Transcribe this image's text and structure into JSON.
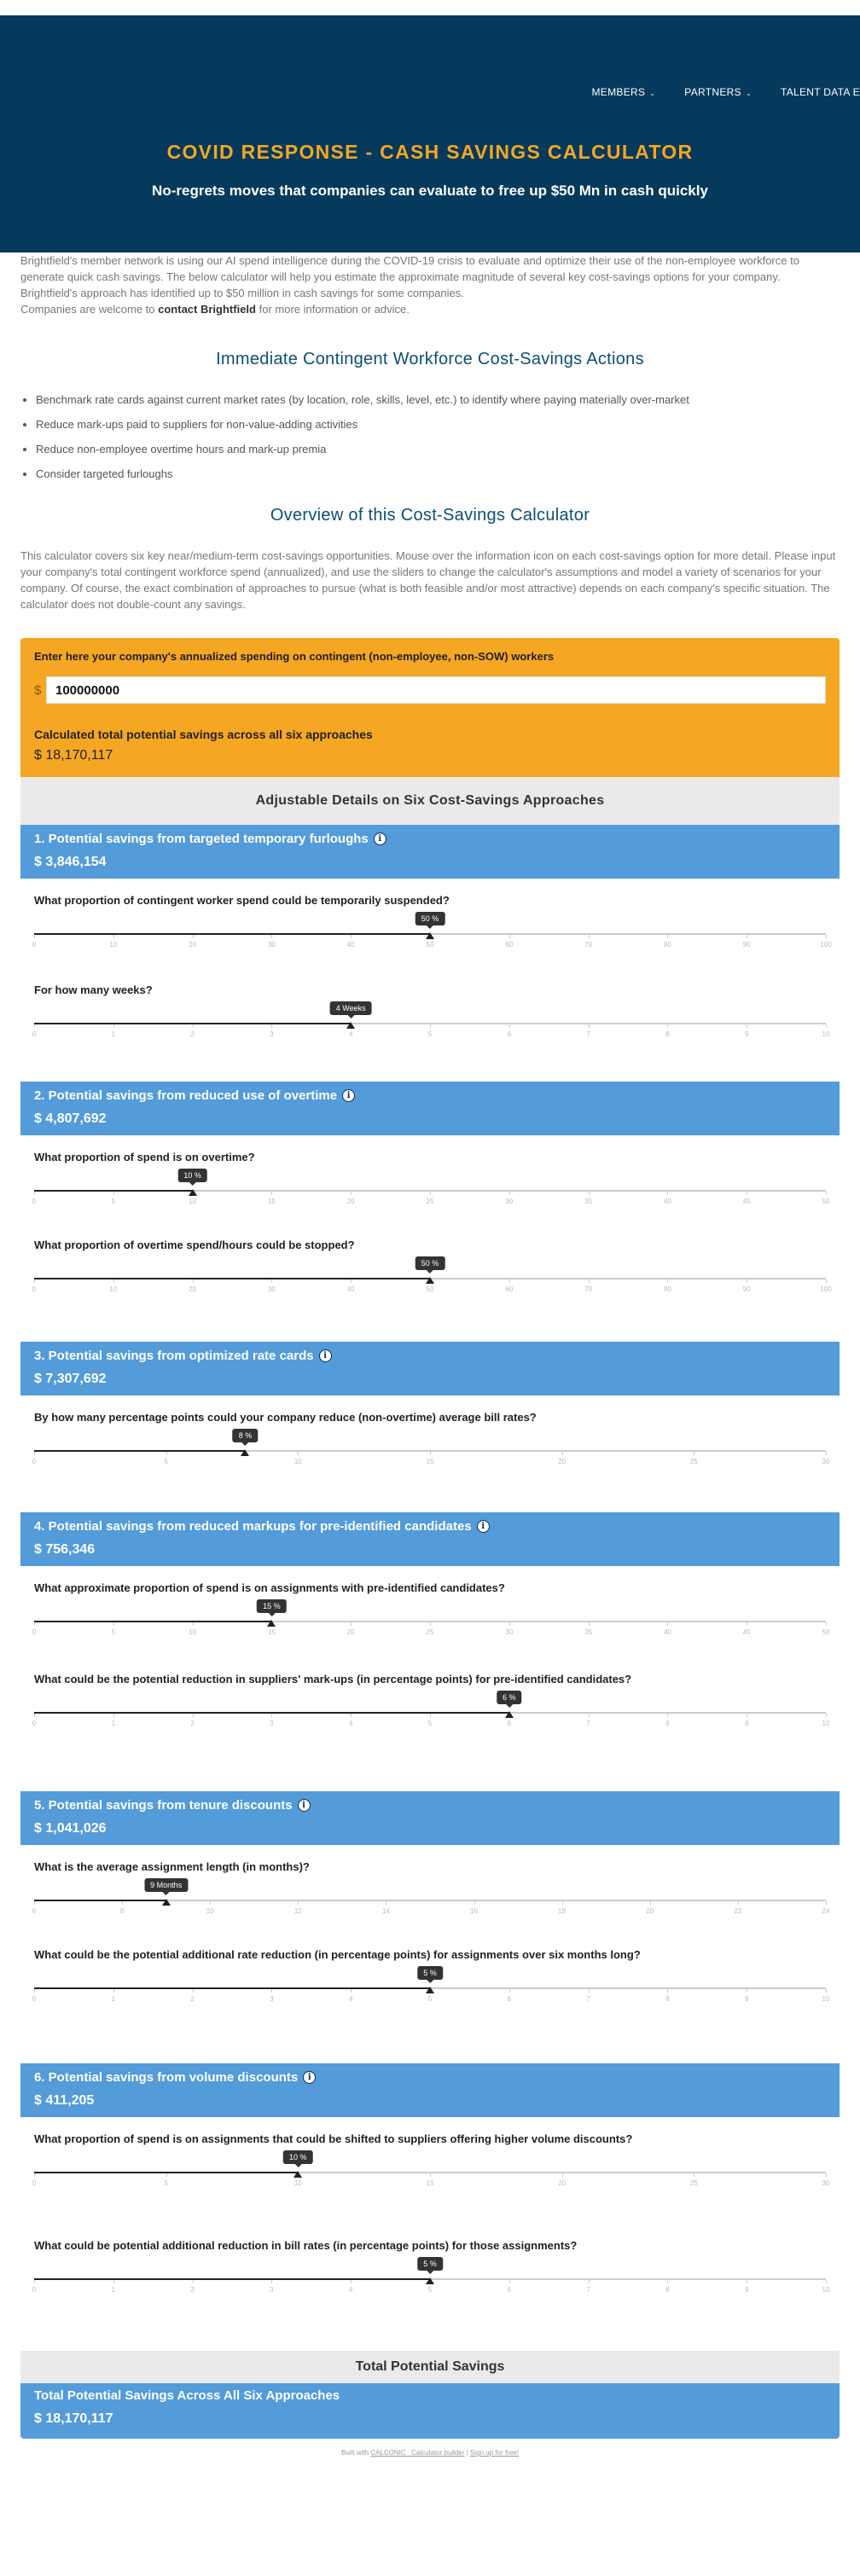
{
  "nav": {
    "items": [
      "MEMBERS",
      "PARTNERS",
      "TALENT DATA E"
    ]
  },
  "hero": {
    "title": "COVID RESPONSE - CASH SAVINGS CALCULATOR",
    "subtitle": "No-regrets moves that companies can evaluate to free up $50 Mn in cash quickly"
  },
  "intro": {
    "paragraph": "Brightfield's member network is using our AI spend intelligence during the COVID-19 crisis to evaluate and optimize their use of the non-employee workforce to generate quick cash savings. The below calculator will help you estimate the approximate magnitude of several key cost-savings options for your company. Brightfield's approach has identified up to $50 million in cash savings for some companies.",
    "contact_prefix": "Companies are welcome to ",
    "contact_bold": "contact Brightfield",
    "contact_suffix": " for more information or advice."
  },
  "actions": {
    "heading": "Immediate Contingent Workforce Cost-Savings Actions",
    "items": [
      "Benchmark rate cards against current market rates (by location, role, skills, level, etc.) to identify where paying materially over-market",
      "Reduce mark-ups paid to suppliers for non-value-adding activities",
      "Reduce non-employee overtime hours and mark-up premia",
      "Consider targeted furloughs"
    ]
  },
  "overview": {
    "heading": "Overview of this Cost-Savings Calculator",
    "paragraph": "This calculator covers six key near/medium-term cost-savings opportunities. Mouse over the information icon on each cost-savings option for more detail. Please input your company's total contingent workforce spend (annualized), and use the sliders to change the calculator's assumptions and model a variety of scenarios for your company.  Of course, the exact combination of approaches to pursue (what is both feasible and/or most attractive) depends on each company's specific situation. The calculator does not double-count any savings."
  },
  "inputs": {
    "spend_label": "Enter here your company's annualized spending on contingent (non-employee, non-SOW) workers",
    "currency": "$",
    "spend_value": "100000000",
    "calc_label": "Calculated total potential savings across all six approaches",
    "calc_value": "$ 18,170,117"
  },
  "adjustable_heading": "Adjustable Details on Six Cost-Savings Approaches",
  "sections": [
    {
      "title": "1. Potential savings from targeted temporary furloughs",
      "value": "$ 3,846,154",
      "sliders": [
        {
          "question": "What proportion of contingent worker spend could be temporarily suspended?",
          "min": 0,
          "max": 100,
          "value": 50,
          "tip": "50 %",
          "ticks": [
            "0",
            "10",
            "20",
            "30",
            "40",
            "50",
            "60",
            "70",
            "80",
            "90",
            "100"
          ]
        },
        {
          "question": "For how many weeks?",
          "min": 0,
          "max": 10,
          "value": 4,
          "tip": "4 Weeks",
          "ticks": [
            "0",
            "1",
            "2",
            "3",
            "4",
            "5",
            "6",
            "7",
            "8",
            "9",
            "10"
          ]
        }
      ]
    },
    {
      "title": "2. Potential savings from reduced use of overtime",
      "value": "$ 4,807,692",
      "sliders": [
        {
          "question": "What proportion of spend is on overtime?",
          "min": 0,
          "max": 50,
          "value": 10,
          "tip": "10 %",
          "ticks": [
            "0",
            "5",
            "10",
            "15",
            "20",
            "25",
            "30",
            "35",
            "40",
            "45",
            "50"
          ]
        },
        {
          "question": "What proportion of overtime spend/hours could be stopped?",
          "min": 0,
          "max": 100,
          "value": 50,
          "tip": "50 %",
          "ticks": [
            "0",
            "10",
            "20",
            "30",
            "40",
            "50",
            "60",
            "70",
            "80",
            "90",
            "100"
          ]
        }
      ]
    },
    {
      "title": "3. Potential savings from optimized rate cards",
      "value": "$ 7,307,692",
      "sliders": [
        {
          "question": "By how many percentage points could your company reduce (non-overtime) average bill rates?",
          "min": 0,
          "max": 30,
          "value": 8,
          "tip": "8 %",
          "ticks": [
            "0",
            "5",
            "10",
            "15",
            "20",
            "25",
            "30"
          ]
        }
      ]
    },
    {
      "title": "4. Potential savings from reduced markups for pre-identified candidates",
      "value": "$ 756,346",
      "sliders": [
        {
          "question": "What approximate proportion of spend is on assignments with pre-identified candidates?",
          "min": 0,
          "max": 50,
          "value": 15,
          "tip": "15 %",
          "ticks": [
            "0",
            "5",
            "10",
            "15",
            "20",
            "25",
            "30",
            "35",
            "40",
            "45",
            "50"
          ]
        },
        {
          "question": "What could be the potential reduction in suppliers' mark-ups (in percentage points) for pre-identified candidates?",
          "min": 0,
          "max": 10,
          "value": 6,
          "tip": "6 %",
          "ticks": [
            "0",
            "1",
            "2",
            "3",
            "4",
            "5",
            "6",
            "7",
            "8",
            "9",
            "10"
          ]
        }
      ]
    },
    {
      "title": "5. Potential savings from tenure discounts",
      "value": "$ 1,041,026",
      "sliders": [
        {
          "question": "What is the average assignment length (in months)?",
          "min": 6,
          "max": 24,
          "value": 9,
          "tip": "9 Months",
          "ticks": [
            "6",
            "8",
            "10",
            "12",
            "14",
            "16",
            "18",
            "20",
            "22",
            "24"
          ]
        },
        {
          "question": "What could be the potential additional rate reduction (in percentage points) for assignments over six months long?",
          "min": 0,
          "max": 10,
          "value": 5,
          "tip": "5 %",
          "ticks": [
            "0",
            "1",
            "2",
            "3",
            "4",
            "5",
            "6",
            "7",
            "8",
            "9",
            "10"
          ]
        }
      ]
    },
    {
      "title": "6. Potential savings from volume discounts",
      "value": "$ 411,205",
      "sliders": [
        {
          "question": "What proportion of spend is on assignments that could be shifted to suppliers offering higher volume discounts?",
          "min": 0,
          "max": 30,
          "value": 10,
          "tip": "10 %",
          "ticks": [
            "0",
            "5",
            "10",
            "15",
            "20",
            "25",
            "30"
          ]
        },
        {
          "question": "What could be potential additional reduction in bill rates (in percentage points) for those assignments?",
          "min": 0,
          "max": 10,
          "value": 5,
          "tip": "5 %",
          "ticks": [
            "0",
            "1",
            "2",
            "3",
            "4",
            "5",
            "6",
            "7",
            "8",
            "9",
            "10"
          ]
        }
      ]
    }
  ],
  "total": {
    "heading": "Total Potential Savings",
    "title": "Total Potential Savings Across All Six Approaches",
    "value": "$ 18,170,117"
  },
  "footer": {
    "prefix": "Built with ",
    "link1": "CALCONIC_ Calculator builder",
    "sep": " | ",
    "link2": "Sign up for free!"
  }
}
